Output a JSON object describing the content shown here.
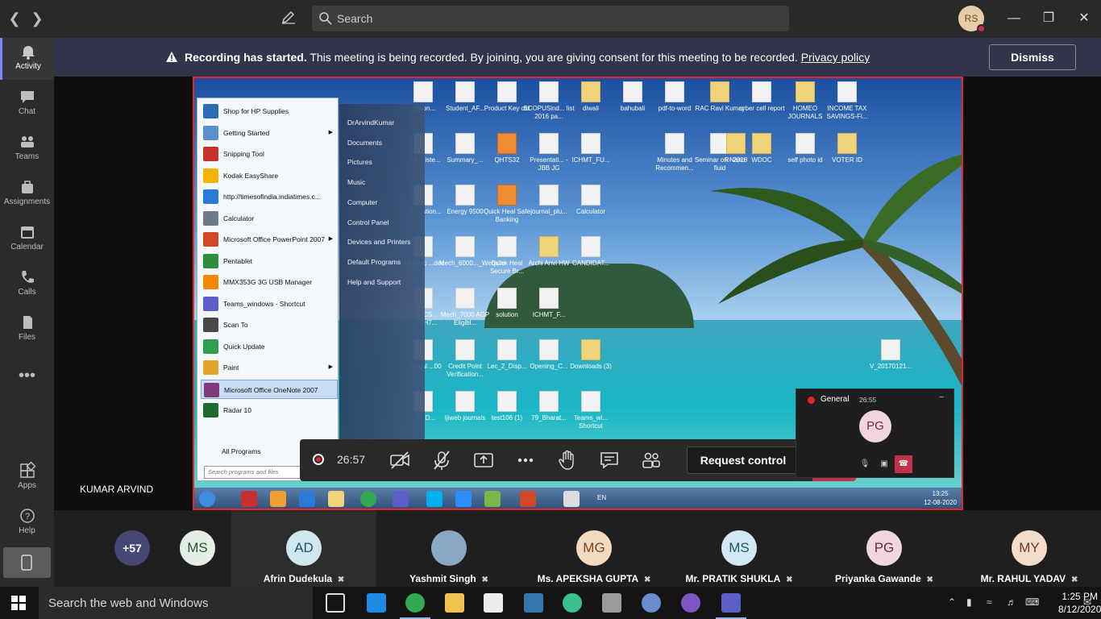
{
  "app": {
    "title": "Microsoft Teams"
  },
  "topbar": {
    "search_placeholder": "Search",
    "user_initials": "RS"
  },
  "rail": {
    "items": [
      {
        "label": "Activity",
        "icon": "bell-icon"
      },
      {
        "label": "Chat",
        "icon": "chat-icon"
      },
      {
        "label": "Teams",
        "icon": "teams-icon"
      },
      {
        "label": "Assignments",
        "icon": "assignments-icon"
      },
      {
        "label": "Calendar",
        "icon": "calendar-icon"
      },
      {
        "label": "Calls",
        "icon": "phone-icon"
      },
      {
        "label": "Files",
        "icon": "files-icon"
      }
    ],
    "more": "•••",
    "bottom": [
      {
        "label": "Apps",
        "icon": "apps-icon"
      },
      {
        "label": "Help",
        "icon": "help-icon"
      }
    ]
  },
  "banner": {
    "title": "Recording has started.",
    "message": "This meeting is being recorded. By joining, you are giving consent for this meeting to be recorded.",
    "link": "Privacy policy",
    "dismiss": "Dismiss"
  },
  "shared_screen": {
    "presenter": "KUMAR ARVIND",
    "start_menu": {
      "left_items": [
        {
          "label": "Shop for HP Supplies",
          "color": "#2a6fb5",
          "arrow": false
        },
        {
          "label": "Getting Started",
          "color": "#5a8fcf",
          "arrow": true
        },
        {
          "label": "Snipping Tool",
          "color": "#c9302c",
          "arrow": false
        },
        {
          "label": "Kodak EasyShare",
          "color": "#f5b400",
          "arrow": false
        },
        {
          "label": "http://timesofindia.indiatimes.c...",
          "color": "#2b7ad6",
          "arrow": false
        },
        {
          "label": "Calculator",
          "color": "#6c7a89",
          "arrow": false
        },
        {
          "label": "Microsoft Office PowerPoint 2007",
          "color": "#d24726",
          "arrow": true
        },
        {
          "label": "Pentablet",
          "color": "#2c8f3c",
          "arrow": false
        },
        {
          "label": "MMX353G 3G USB Manager",
          "color": "#f28a00",
          "arrow": false
        },
        {
          "label": "Teams_windows - Shortcut",
          "color": "#5b5fc7",
          "arrow": false
        },
        {
          "label": "Scan To",
          "color": "#4a4a4a",
          "arrow": false
        },
        {
          "label": "Quick Update",
          "color": "#2e9e4f",
          "arrow": false
        },
        {
          "label": "Paint",
          "color": "#e2a42b",
          "arrow": true
        },
        {
          "label": "Microsoft Office OneNote 2007",
          "color": "#80397b",
          "arrow": false
        },
        {
          "label": "Radar 10",
          "color": "#1d6b2f",
          "arrow": false
        }
      ],
      "right_items": [
        "DrArvindKumar",
        "Documents",
        "Pictures",
        "Music",
        "Computer",
        "Control Panel",
        "Devices and Printers",
        "Default Programs",
        "Help and Support"
      ],
      "all_programs": "All Programs",
      "search_placeholder": "Search programs and files"
    },
    "desktop_icons": [
      {
        "label": "...ction...",
        "type": "doc"
      },
      {
        "label": "Student_AF...",
        "type": "doc"
      },
      {
        "label": "Product Key old",
        "type": "doc"
      },
      {
        "label": "SCOPUSind... list 2016 pa...",
        "type": "doc"
      },
      {
        "label": "diwali",
        "type": "folder"
      },
      {
        "label": "bahubali",
        "type": "doc"
      },
      {
        "label": "pdf-to-word",
        "type": "doc"
      },
      {
        "label": "RAC Ravi Kumar",
        "type": "folder"
      },
      {
        "label": "cyber cell report",
        "type": "doc"
      },
      {
        "label": "HOMEO JOURNALS",
        "type": "folder"
      },
      {
        "label": "INCOME TAX SAVINGS-Fi...",
        "type": "doc"
      },
      {
        "label": "...of ...liste...",
        "type": "doc"
      },
      {
        "label": "Summary_...",
        "type": "doc"
      },
      {
        "label": "QHTS32",
        "type": "orange"
      },
      {
        "label": "Presentati... - JBB JG",
        "type": "doc"
      },
      {
        "label": "ICHMT_FU...",
        "type": "doc"
      },
      {
        "label": "Minutes and Recommen...",
        "type": "doc"
      },
      {
        "label": "Seminar on Nano fluid",
        "type": "doc"
      },
      {
        "label": "WDOC",
        "type": "folder"
      },
      {
        "label": "self photo id",
        "type": "doc"
      },
      {
        "label": "VOTER ID",
        "type": "folder"
      },
      {
        "label": "R- 2018",
        "type": "folder"
      },
      {
        "label": "...D ...ation...",
        "type": "doc"
      },
      {
        "label": "Energy 9500",
        "type": "doc"
      },
      {
        "label": "Quick Heal Safe Banking",
        "type": "orange"
      },
      {
        "label": "journal_plu...",
        "type": "doc"
      },
      {
        "label": "Calculator",
        "type": "doc"
      },
      {
        "label": "...A upsc ...dec",
        "type": "doc"
      },
      {
        "label": "Mech_6000..._Website",
        "type": "doc"
      },
      {
        "label": "Quick Heal Secure Br...",
        "type": "doc"
      },
      {
        "label": "Archi Anvi HW",
        "type": "folder"
      },
      {
        "label": "CANDIDAT...",
        "type": "doc"
      },
      {
        "label": "...nt_CS... ...CSH7...",
        "type": "doc"
      },
      {
        "label": "Mech_7000 AGP Eligibl...",
        "type": "doc"
      },
      {
        "label": "solution",
        "type": "doc"
      },
      {
        "label": "ICHMT_F...",
        "type": "doc"
      },
      {
        "label": "...ubical ...00",
        "type": "doc"
      },
      {
        "label": "Credit Point Verification...",
        "type": "doc"
      },
      {
        "label": "Lec_2_Disp...",
        "type": "doc"
      },
      {
        "label": "Opening_C...",
        "type": "doc"
      },
      {
        "label": "Downloads (3)",
        "type": "folder"
      },
      {
        "label": "V_20170121...",
        "type": "doc"
      },
      {
        "label": "...n...D...",
        "type": "doc"
      },
      {
        "label": "Ijiweb journals",
        "type": "doc"
      },
      {
        "label": "test106 (1)",
        "type": "doc"
      },
      {
        "label": "79_Bharat...",
        "type": "doc"
      },
      {
        "label": "Teams_wi... Shortcut",
        "type": "doc"
      }
    ],
    "taskbar": {
      "lang": "EN",
      "time": "13:25",
      "date": "12-08-2020"
    }
  },
  "call_controls": {
    "timer": "26:57",
    "request_control": "Request control"
  },
  "mini_window": {
    "channel": "General",
    "timer": "26:55",
    "initials": "PG"
  },
  "roster": {
    "overflow": "+57",
    "participants": [
      {
        "initials": "MS",
        "name": "",
        "bg": "#e3eee4",
        "fg": "#2f4e35",
        "muted": false
      },
      {
        "initials": "AD",
        "name": "Afrin Dudekula",
        "bg": "#cfe8f0",
        "fg": "#1f5465",
        "muted": true
      },
      {
        "initials": "",
        "name": "Yashmit Singh",
        "bg": "#8aa7c4",
        "fg": "#fff",
        "muted": true
      },
      {
        "initials": "MG",
        "name": "Ms. APEKSHA GUPTA",
        "bg": "#f4d9c3",
        "fg": "#7a4418",
        "muted": true
      },
      {
        "initials": "MS",
        "name": "Mr. PRATIK SHUKLA",
        "bg": "#d2e9f3",
        "fg": "#1e5468",
        "muted": true
      },
      {
        "initials": "PG",
        "name": "Priyanka Gawande",
        "bg": "#f3d5dd",
        "fg": "#6b2a3c",
        "muted": true
      },
      {
        "initials": "MY",
        "name": "Mr. RAHUL YADAV",
        "bg": "#f4dccc",
        "fg": "#6e3a1d",
        "muted": true
      }
    ]
  },
  "windows_taskbar": {
    "search_placeholder": "Search the web and Windows",
    "time": "1:25 PM",
    "date": "8/12/2020"
  }
}
